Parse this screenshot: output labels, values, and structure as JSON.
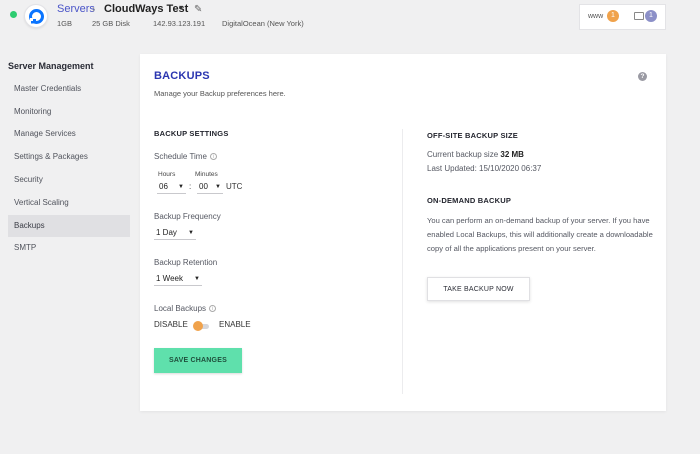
{
  "header": {
    "breadcrumb_servers": "Servers",
    "breadcrumb_sep": "›",
    "server_name": "CloudWays Test",
    "caret": "▾",
    "edit_icon": "✎",
    "ram": "1GB",
    "disk": "25 GB Disk",
    "ip": "142.93.123.191",
    "provider": "DigitalOcean (New York)",
    "www_label": "www",
    "www_count": "1",
    "folder_count": "1"
  },
  "sidebar": {
    "title": "Server Management",
    "items": [
      {
        "label": "Master Credentials"
      },
      {
        "label": "Monitoring"
      },
      {
        "label": "Manage Services"
      },
      {
        "label": "Settings & Packages"
      },
      {
        "label": "Security"
      },
      {
        "label": "Vertical Scaling"
      },
      {
        "label": "Backups",
        "active": true
      },
      {
        "label": "SMTP"
      }
    ]
  },
  "main": {
    "title": "BACKUPS",
    "subtitle": "Manage your Backup preferences here.",
    "help": "?",
    "settings": {
      "title": "BACKUP SETTINGS",
      "schedule_label": "Schedule Time",
      "hours_label": "Hours",
      "minutes_label": "Minutes",
      "hours_value": "06",
      "minutes_value": "00",
      "colon": ":",
      "timezone": "UTC",
      "frequency_label": "Backup Frequency",
      "frequency_value": "1 Day",
      "retention_label": "Backup Retention",
      "retention_value": "1 Week",
      "local_label": "Local Backups",
      "disable": "DISABLE",
      "enable": "ENABLE",
      "save_button": "SAVE CHANGES"
    },
    "offsite": {
      "title": "OFF-SITE BACKUP SIZE",
      "current_label": "Current backup size",
      "current_value": "32 MB",
      "last_updated": "Last Updated: 15/10/2020 06:37"
    },
    "ondemand": {
      "title": "ON-DEMAND BACKUP",
      "description": "You can perform an on-demand backup of your server. If you have enabled Local Backups, this will additionally create a downloadable copy of all the applications present on your server.",
      "button": "TAKE BACKUP NOW"
    }
  },
  "colors": {
    "accent": "#2b36b0",
    "link": "#4a54c8",
    "online": "#2ecc71",
    "save_button": "#5fe0ac",
    "toggle_knob": "#f0a24b",
    "www_badge": "#f0a24b",
    "folder_badge": "#8c90c8"
  },
  "icons": {
    "logo": "digitalocean-logo",
    "edit": "pencil-icon",
    "help": "help-circle-icon",
    "info": "info-icon",
    "folder": "folder-icon"
  }
}
